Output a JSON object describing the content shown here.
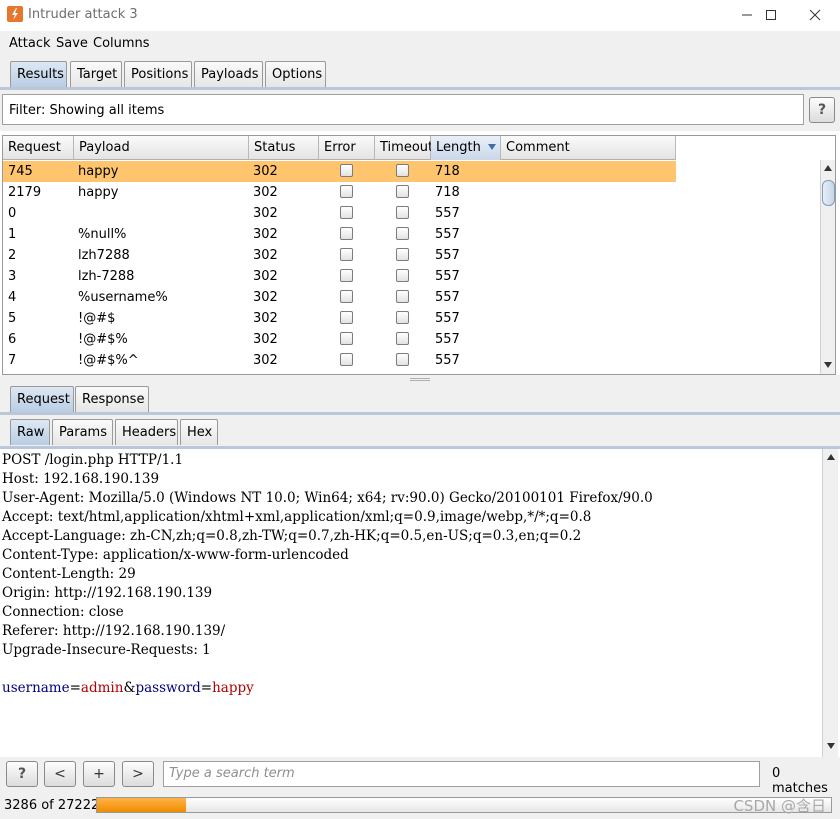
{
  "window": {
    "title": "Intruder attack 3",
    "accent_color": "#e8772e"
  },
  "menu": [
    "Attack",
    "Save",
    "Columns"
  ],
  "tabs": [
    "Results",
    "Target",
    "Positions",
    "Payloads",
    "Options"
  ],
  "active_tab": "Results",
  "filter": {
    "text": "Filter: Showing all items",
    "help_label": "?"
  },
  "results_table": {
    "columns": [
      "Request",
      "Payload",
      "Status",
      "Error",
      "Timeout",
      "Length",
      "Comment"
    ],
    "sorted_column": "Length",
    "selected_row_color": "#ffc56e",
    "rows": [
      {
        "request": "745",
        "payload": "happy",
        "status": "302",
        "error": false,
        "timeout": false,
        "length": "718",
        "comment": "",
        "selected": true
      },
      {
        "request": "2179",
        "payload": "happy",
        "status": "302",
        "error": false,
        "timeout": false,
        "length": "718",
        "comment": ""
      },
      {
        "request": "0",
        "payload": "",
        "status": "302",
        "error": false,
        "timeout": false,
        "length": "557",
        "comment": ""
      },
      {
        "request": "1",
        "payload": "%null%",
        "status": "302",
        "error": false,
        "timeout": false,
        "length": "557",
        "comment": ""
      },
      {
        "request": "2",
        "payload": "lzh7288",
        "status": "302",
        "error": false,
        "timeout": false,
        "length": "557",
        "comment": ""
      },
      {
        "request": "3",
        "payload": "lzh-7288",
        "status": "302",
        "error": false,
        "timeout": false,
        "length": "557",
        "comment": ""
      },
      {
        "request": "4",
        "payload": "%username%",
        "status": "302",
        "error": false,
        "timeout": false,
        "length": "557",
        "comment": ""
      },
      {
        "request": "5",
        "payload": "!@#$",
        "status": "302",
        "error": false,
        "timeout": false,
        "length": "557",
        "comment": ""
      },
      {
        "request": "6",
        "payload": "!@#$%",
        "status": "302",
        "error": false,
        "timeout": false,
        "length": "557",
        "comment": ""
      },
      {
        "request": "7",
        "payload": "!@#$%^",
        "status": "302",
        "error": false,
        "timeout": false,
        "length": "557",
        "comment": ""
      }
    ]
  },
  "detail_tabs": [
    "Request",
    "Response"
  ],
  "active_detail_tab": "Request",
  "view_tabs": [
    "Raw",
    "Params",
    "Headers",
    "Hex"
  ],
  "active_view_tab": "Raw",
  "request_lines": [
    "POST /login.php HTTP/1.1",
    "Host: 192.168.190.139",
    "User-Agent: Mozilla/5.0 (Windows NT 10.0; Win64; x64; rv:90.0) Gecko/20100101 Firefox/90.0",
    "Accept: text/html,application/xhtml+xml,application/xml;q=0.9,image/webp,*/*;q=0.8",
    "Accept-Language: zh-CN,zh;q=0.8,zh-TW;q=0.7,zh-HK;q=0.5,en-US;q=0.3,en;q=0.2",
    "Content-Type: application/x-www-form-urlencoded",
    "Content-Length: 29",
    "Origin: http://192.168.190.139",
    "Connection: close",
    "Referer: http://192.168.190.139/",
    "Upgrade-Insecure-Requests: 1"
  ],
  "request_body": {
    "name1": "username",
    "eq1": "=",
    "value1": "admin",
    "amp": "&",
    "name2": "password",
    "eq2": "=",
    "value2": "happy"
  },
  "search": {
    "help_label": "?",
    "prev_label": "<",
    "add_label": "+",
    "next_label": ">",
    "placeholder": "Type a search term",
    "matches": "0 matches"
  },
  "progress": {
    "label": "3286 of 27222",
    "completed": 3286,
    "total": 27222
  },
  "watermark": "CSDN @含日"
}
